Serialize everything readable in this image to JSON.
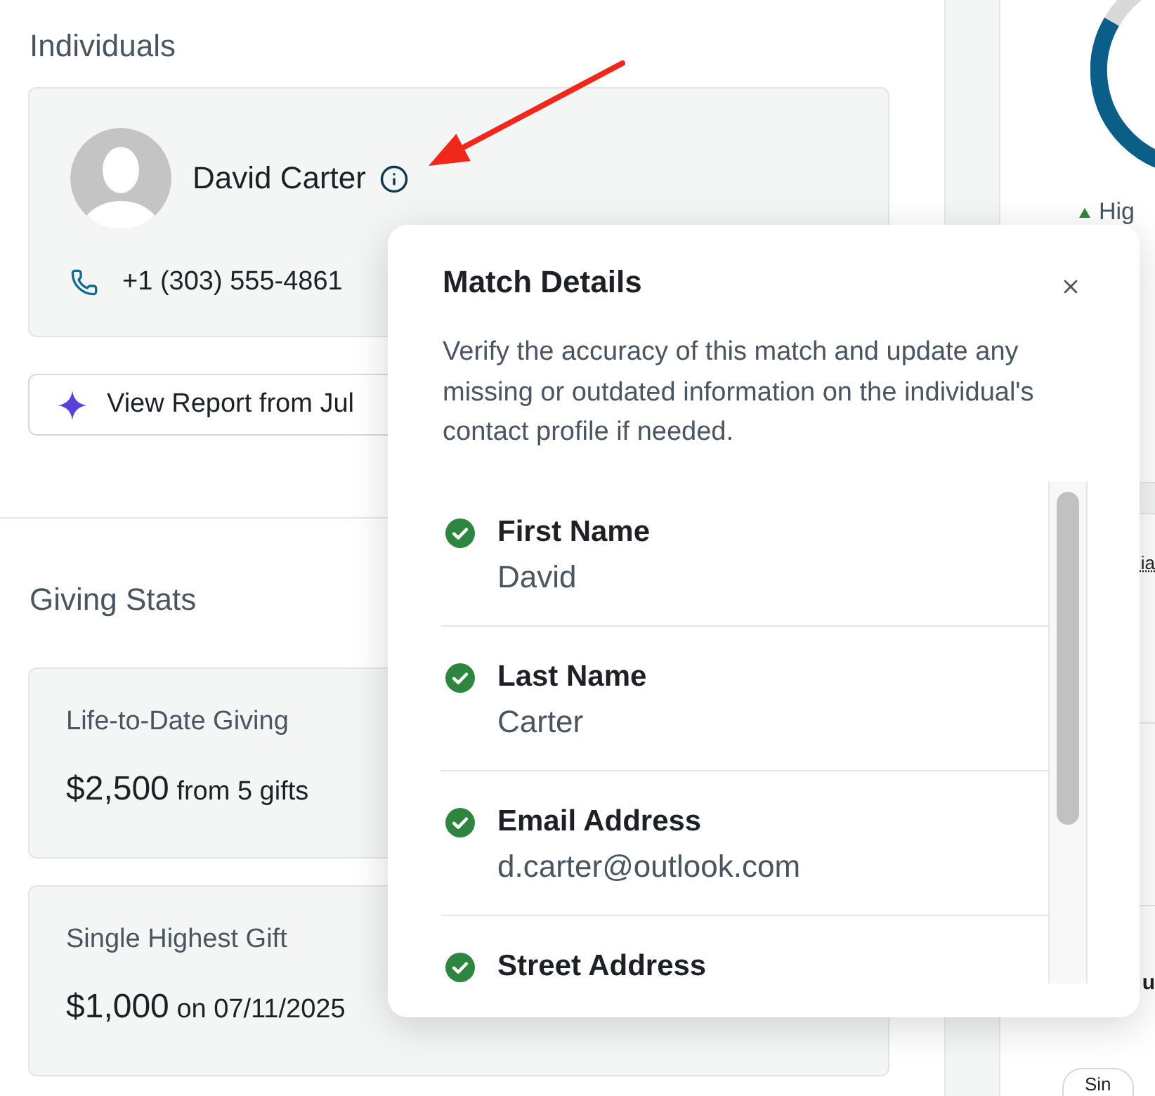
{
  "individuals": {
    "heading": "Individuals",
    "person": {
      "name": "David Carter",
      "phone": "+1 (303) 555-4861"
    },
    "report_button": {
      "label": "View Report from Jul"
    }
  },
  "giving_stats": {
    "heading": "Giving Stats",
    "cards": [
      {
        "label": "Life-to-Date Giving",
        "amount": "$2,500",
        "detail": "from 5 gifts"
      },
      {
        "label": "Single Highest Gift",
        "amount": "$1,000",
        "detail": "on 07/11/2025"
      }
    ]
  },
  "side_panel": {
    "trend": {
      "label": "Hig"
    },
    "card_text": "ia",
    "heading": "u",
    "chip": "Sin"
  },
  "match_details": {
    "title": "Match Details",
    "description": "Verify the accuracy of this match and update any missing or outdated information on the individual's contact profile if needed.",
    "fields": [
      {
        "label": "First Name",
        "value": "David",
        "verified": true
      },
      {
        "label": "Last Name",
        "value": "Carter",
        "verified": true
      },
      {
        "label": "Email Address",
        "value": "d.carter@outlook.com",
        "verified": true
      },
      {
        "label": "Street Address",
        "verified": true
      }
    ]
  }
}
